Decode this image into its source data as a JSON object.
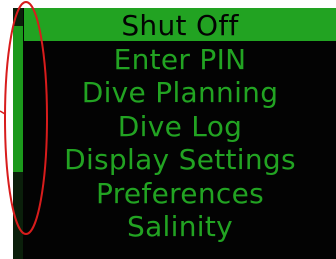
{
  "menu": {
    "items": [
      {
        "label": "Shut Off",
        "selected": true
      },
      {
        "label": "Enter PIN",
        "selected": false
      },
      {
        "label": "Dive Planning",
        "selected": false
      },
      {
        "label": "Dive Log",
        "selected": false
      },
      {
        "label": "Display Settings",
        "selected": false
      },
      {
        "label": "Preferences",
        "selected": false
      },
      {
        "label": "Salinity",
        "selected": false
      }
    ]
  },
  "scrollbar": {
    "position_fraction": 0.07,
    "visible_fraction": 0.58
  },
  "colors": {
    "screen_background": "#030303",
    "text_green": "#22a322",
    "annotation_red": "#d81c1c"
  },
  "annotation": {
    "shape": "ellipse",
    "target": "scrollbar"
  }
}
